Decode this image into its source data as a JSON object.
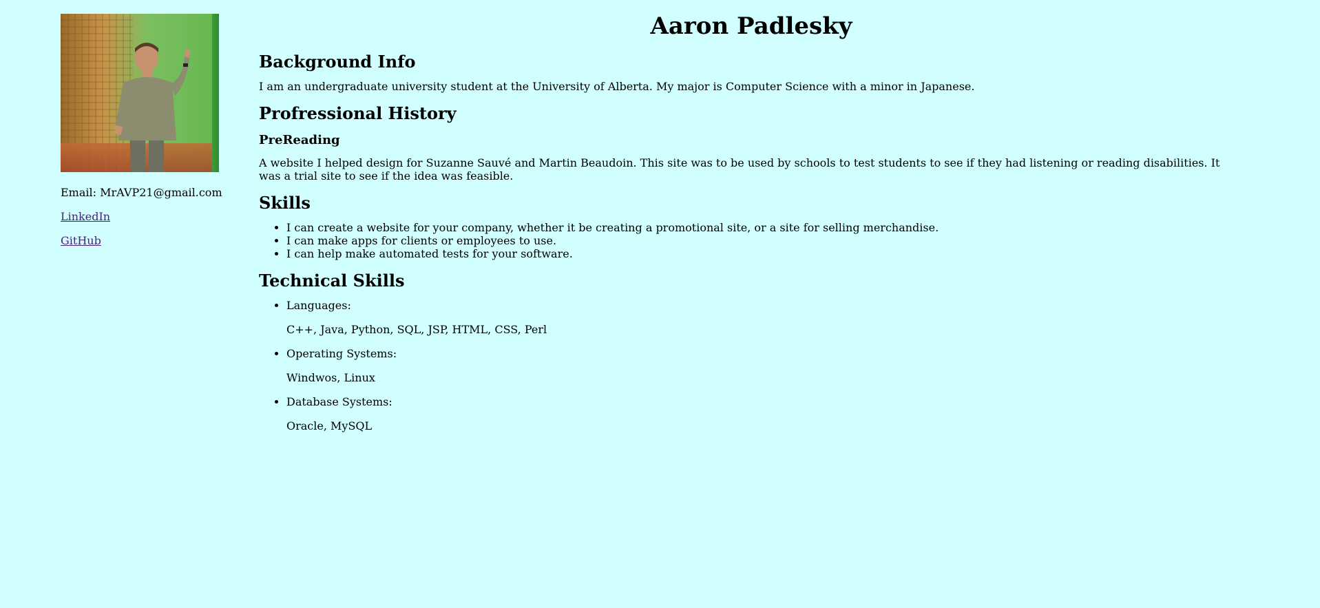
{
  "sidebar": {
    "email": "Email: MrAVP21@gmail.com",
    "links": [
      {
        "label": "LinkedIn"
      },
      {
        "label": "GitHub"
      }
    ]
  },
  "main": {
    "title": "Aaron Padlesky",
    "background": {
      "heading": "Background Info",
      "text": "I am an undergraduate university student at the University of Alberta. My major is Computer Science with a minor in Japanese."
    },
    "professional_history": {
      "heading": "Profressional History",
      "project_title": "PreReading",
      "project_text": "A website I helped design for Suzanne Sauvé and Martin Beaudoin. This site was to be used by schools to test students to see if they had listening or reading disabilities. It was a trial site to see if the idea was feasible."
    },
    "skills": {
      "heading": "Skills",
      "items": [
        "I can create a website for your company, whether it be creating a promotional site, or a site for selling merchandise.",
        "I can make apps for clients or employees to use.",
        "I can help make automated tests for your software."
      ]
    },
    "technical_skills": {
      "heading": "Technical Skills",
      "items": [
        {
          "title": "Languages:",
          "value": "C++, Java, Python, SQL, JSP, HTML, CSS, Perl"
        },
        {
          "title": "Operating Systems:",
          "value": "Windwos, Linux"
        },
        {
          "title": "Database Systems:",
          "value": "Oracle, MySQL"
        }
      ]
    }
  }
}
